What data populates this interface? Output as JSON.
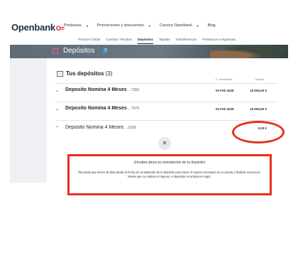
{
  "header": {
    "logo": "Openbank",
    "logo_symbol": "O=",
    "nav": [
      {
        "label": "Productos",
        "has_menu": true
      },
      {
        "label": "Promociones y descuentos",
        "has_menu": true
      },
      {
        "label": "Conoce Openbank",
        "has_menu": true
      },
      {
        "label": "Blog",
        "has_menu": false
      }
    ]
  },
  "subnav": {
    "tabs": [
      {
        "label": "Posición Global",
        "active": false
      },
      {
        "label": "Cuentas / Recibos",
        "active": false
      },
      {
        "label": "Depósitos",
        "active": true
      },
      {
        "label": "Tarjetas",
        "active": false
      },
      {
        "label": "Transferencias",
        "active": false
      },
      {
        "label": "Préstamos e Hipotecas",
        "active": false
      }
    ]
  },
  "hero": {
    "title": "Depósitos",
    "info_icon": "?"
  },
  "deposits": {
    "heading": "Tus depósitos",
    "count": "(3)",
    "col_date": "F. Vencimiento",
    "col_amount": "Importe",
    "rows": [
      {
        "name": "Deposito Nomina 4 Meses",
        "account": "...7363",
        "date": "03 Feb 2026",
        "amount": "10.000,00 €",
        "expanded": false
      },
      {
        "name": "Deposito Nomina 4 Meses",
        "account": "...7373",
        "date": "03 Feb 2026",
        "amount": "10.000,00 €",
        "expanded": false
      },
      {
        "name": "Deposito Nomina 4 Meses",
        "account": "...3160",
        "date": "",
        "amount": "0,00 €",
        "expanded": true
      }
    ]
  },
  "alert": {
    "title": "¡Finaliza ahora la contratación de tu depósito!",
    "text": "Recuerda que tienes 45 días desde la fecha de contratación de tu depósito para hacer el ingreso necesario en tu cuenta y finalizar el proceso. Mesta que no realices el ingreso, el depósito no entrará en vigor."
  },
  "colors": {
    "brand": "#ec0000",
    "annotation": "#e8301c",
    "navy": "#1b2a4a"
  }
}
